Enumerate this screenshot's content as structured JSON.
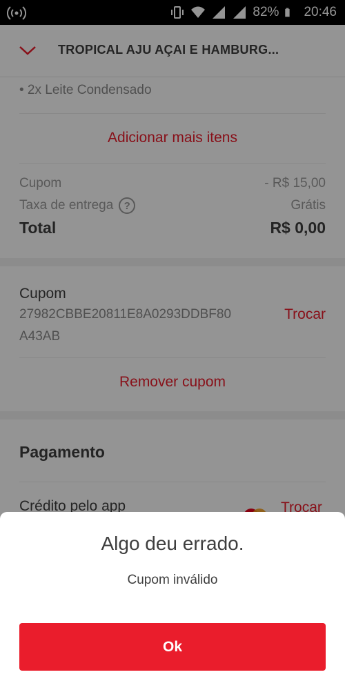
{
  "status_bar": {
    "battery_text": "82%",
    "time": "20:46",
    "icons": [
      "wifi-hotspot-icon",
      "vibrate-icon",
      "wifi-icon",
      "signal-icon",
      "signal-icon",
      "battery-icon"
    ]
  },
  "header": {
    "back_icon": "chevron-down-icon",
    "title": "TROPICAL AJU AÇAI E HAMBURG..."
  },
  "order": {
    "item_line": "• 2x Leite Condensado",
    "add_more": "Adicionar mais itens"
  },
  "summary": {
    "coupon_label": "Cupom",
    "coupon_value": "- R$ 15,00",
    "delivery_label": "Taxa de entrega",
    "delivery_help": "?",
    "delivery_value": "Grátis",
    "total_label": "Total",
    "total_value": "R$ 0,00"
  },
  "coupon": {
    "title": "Cupom",
    "code": "27982CBBE20811E8A0293DDBF80A43AB",
    "change_label": "Trocar",
    "remove_label": "Remover cupom"
  },
  "payment": {
    "title": "Pagamento",
    "method": "Crédito pelo app",
    "card_icon": "mastercard-icon",
    "change_label": "Trocar"
  },
  "dialog": {
    "title": "Algo deu errado.",
    "message": "Cupom inválido",
    "ok_label": "Ok"
  },
  "colors": {
    "accent": "#ea1d2c",
    "text": "#3e3e3e",
    "muted": "#9a9a9a"
  }
}
